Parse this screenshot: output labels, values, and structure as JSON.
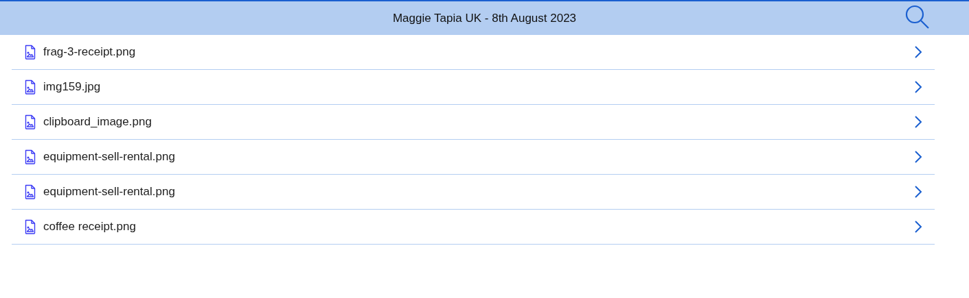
{
  "header": {
    "title": "Maggie Tapia UK - 8th August 2023"
  },
  "files": [
    {
      "name": "frag-3-receipt.png"
    },
    {
      "name": "img159.jpg"
    },
    {
      "name": "clipboard_image.png"
    },
    {
      "name": "equipment-sell-rental.png"
    },
    {
      "name": "equipment-sell-rental.png"
    },
    {
      "name": "coffee receipt.png"
    }
  ]
}
